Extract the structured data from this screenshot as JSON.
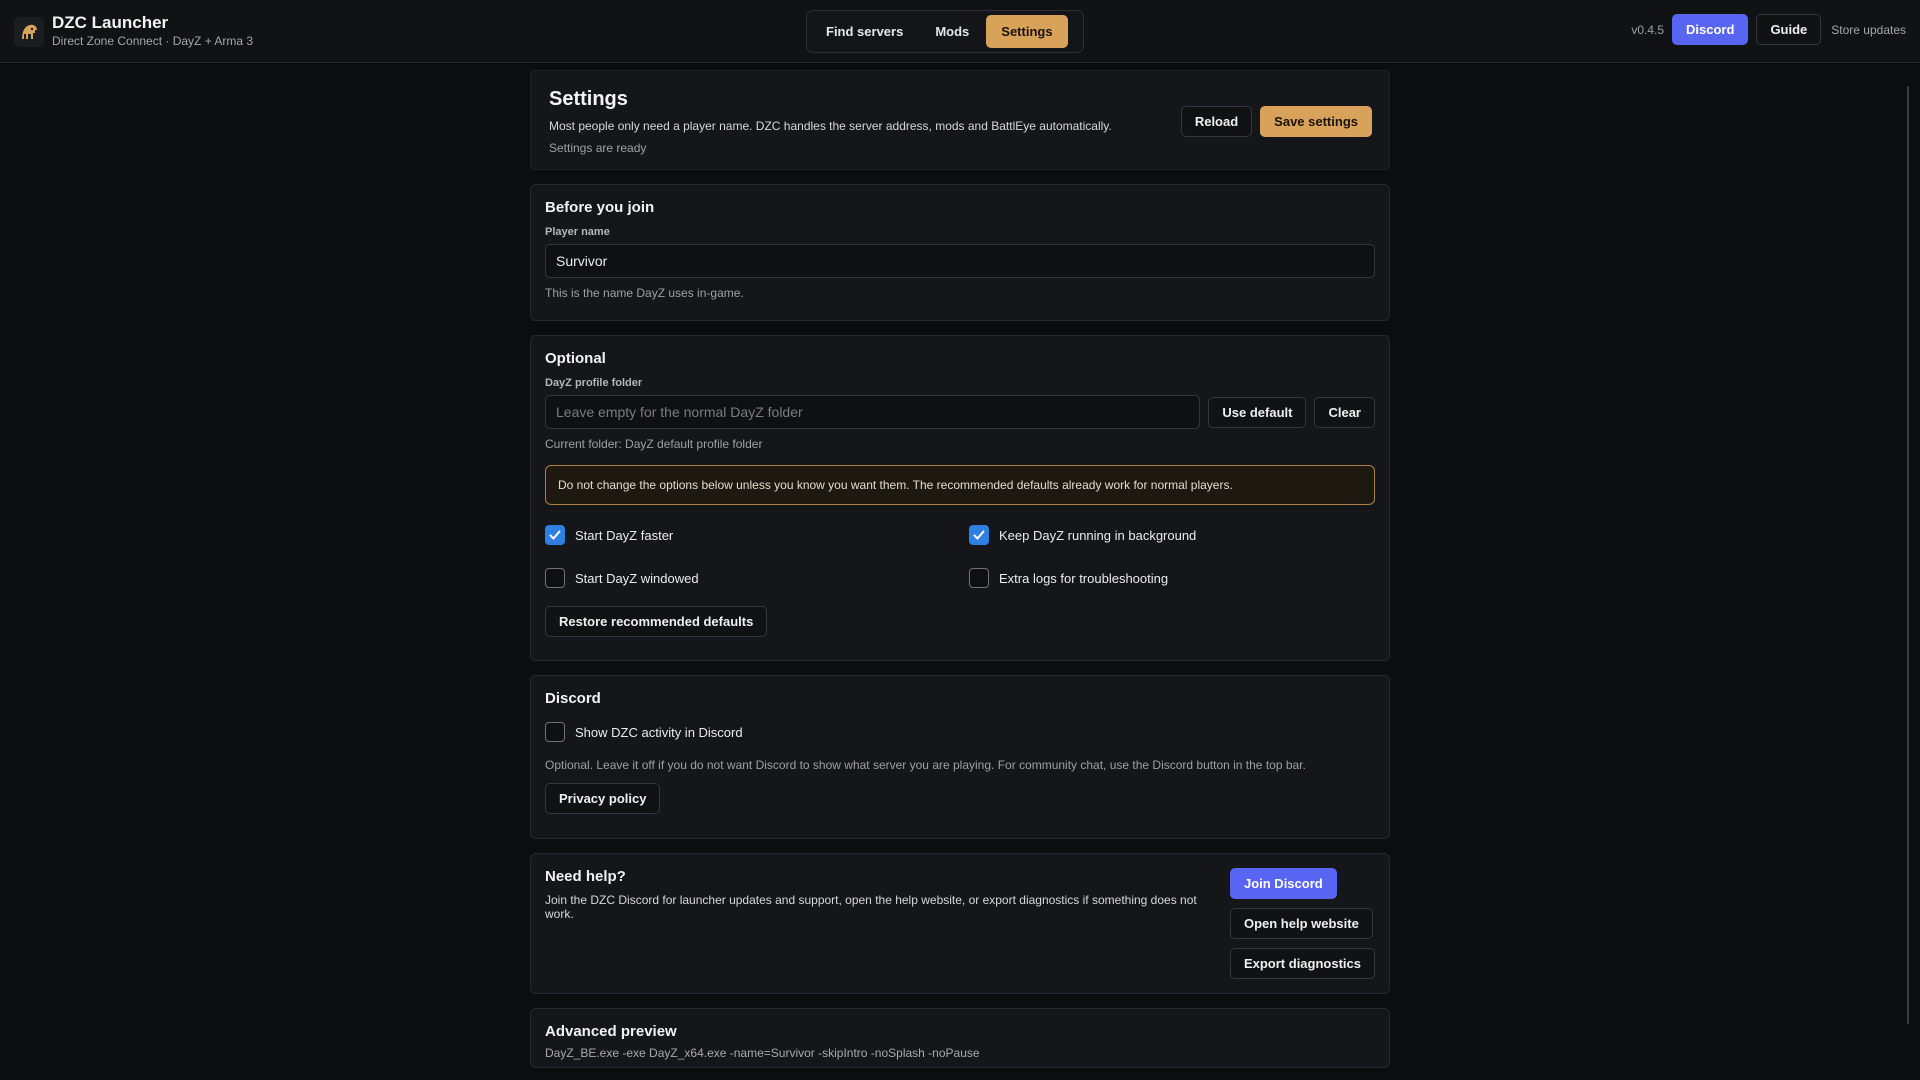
{
  "app": {
    "title": "DZC Launcher",
    "subtitle": "Direct Zone Connect · DayZ + Arma 3",
    "version": "v0.4.5"
  },
  "nav": {
    "tabs": [
      {
        "label": "Find servers",
        "active": false
      },
      {
        "label": "Mods",
        "active": false
      },
      {
        "label": "Settings",
        "active": true
      }
    ],
    "discord_label": "Discord",
    "guide_label": "Guide",
    "store_updates_label": "Store updates"
  },
  "settings": {
    "title": "Settings",
    "description": "Most people only need a player name. DZC handles the server address, mods and BattlEye automatically.",
    "status": "Settings are ready",
    "reload_label": "Reload",
    "save_label": "Save settings"
  },
  "before_join": {
    "title": "Before you join",
    "player_name_label": "Player name",
    "player_name_value": "Survivor",
    "player_name_hint": "This is the name DayZ uses in-game."
  },
  "optional": {
    "title": "Optional",
    "profile_folder_label": "DayZ profile folder",
    "profile_folder_value": "",
    "profile_folder_placeholder": "Leave empty for the normal DayZ folder",
    "use_default_label": "Use default",
    "clear_label": "Clear",
    "current_folder": "Current folder: DayZ default profile folder",
    "warning": "Do not change the options below unless you know you want them. The recommended defaults already work for normal players.",
    "options": [
      {
        "label": "Start DayZ faster",
        "checked": true
      },
      {
        "label": "Keep DayZ running in background",
        "checked": true
      },
      {
        "label": "Start DayZ windowed",
        "checked": false
      },
      {
        "label": "Extra logs for troubleshooting",
        "checked": false
      }
    ],
    "restore_label": "Restore recommended defaults"
  },
  "discord": {
    "title": "Discord",
    "activity_label": "Show DZC activity in Discord",
    "activity_checked": false,
    "description": "Optional. Leave it off if you do not want Discord to show what server you are playing. For community chat, use the Discord button in the top bar.",
    "privacy_label": "Privacy policy"
  },
  "help": {
    "title": "Need help?",
    "description": "Join the DZC Discord for launcher updates and support, open the help website, or export diagnostics if something does not work.",
    "join_discord_label": "Join Discord",
    "help_website_label": "Open help website",
    "export_label": "Export diagnostics"
  },
  "advanced": {
    "title": "Advanced preview",
    "command": "DayZ_BE.exe -exe DayZ_x64.exe -name=Survivor -skipIntro -noSplash -noPause"
  },
  "colors": {
    "accent_gold": "#d9a25b",
    "discord_blurple": "#5865f2",
    "checkbox_blue": "#2f7fe0",
    "warning_border": "#a6803f"
  }
}
